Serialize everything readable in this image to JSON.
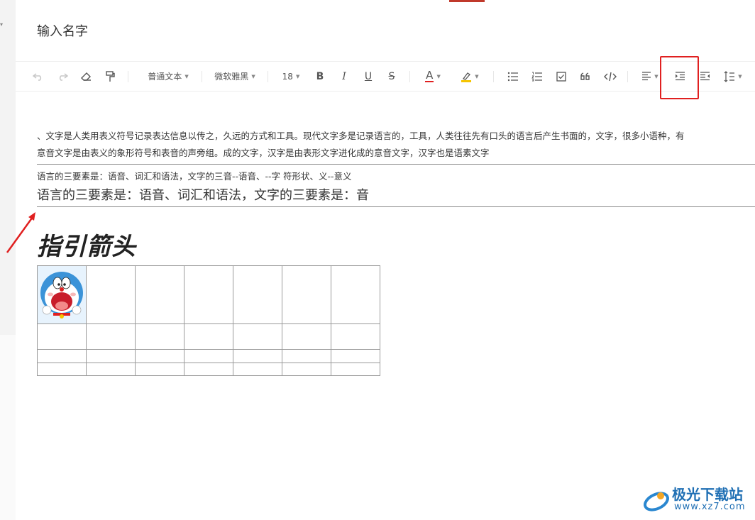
{
  "document": {
    "title": "输入名字"
  },
  "toolbar": {
    "paragraph_style": "普通文本",
    "font_family": "微软雅黑",
    "font_size": "18",
    "bold_label": "B",
    "italic_label": "I",
    "underline_label": "U",
    "strike_label": "S",
    "font_color_label": "A",
    "font_color": "#e02020",
    "highlight_color": "#f5c400",
    "highlighted_tool": "indent"
  },
  "content": {
    "paragraph1_line1": "、文字是人类用表义符号记录表达信息以传之，久远的方式和工具。现代文字多是记录语言的，工具，人类往往先有口头的语言后产生书面的，文字，很多小语种，有",
    "paragraph1_line2": "意音文字是由表义的象形符号和表音的声旁组。成的文字，汉字是由表形文字进化成的意音文字，汉字也是语素文字",
    "small_line": "语言的三要素是：语音、词汇和语法，文字的三音--语音、--字  符形状、义--意义",
    "big_line": "语言的三要素是：语音、词汇和语法，文字的三要素是：音",
    "heading": "指引箭头"
  },
  "table": {
    "columns": 7,
    "rows": 4
  },
  "watermark": {
    "name": "极光下载站",
    "url": "www.xz7.com"
  }
}
